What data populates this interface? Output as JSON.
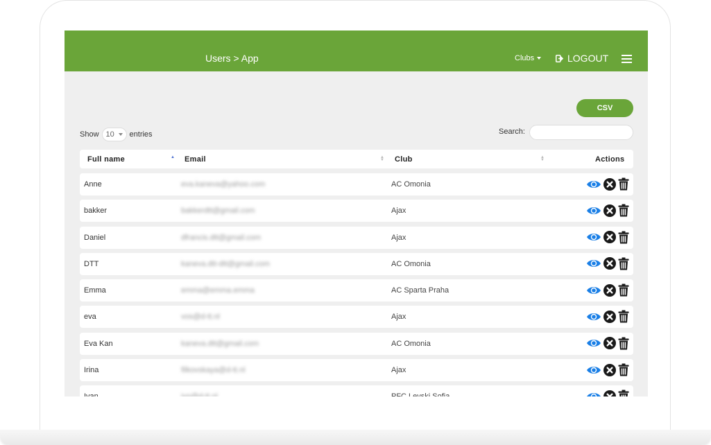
{
  "header": {
    "breadcrumb": "Users > App",
    "clubs_menu": "Clubs",
    "logout": "LOGOUT"
  },
  "toolbar": {
    "csv": "CSV",
    "show": "Show",
    "entries_value": "10",
    "entries": "entries",
    "search_label": "Search:",
    "search_value": ""
  },
  "table": {
    "columns": {
      "full_name": "Full name",
      "email": "Email",
      "club": "Club",
      "actions": "Actions"
    },
    "rows": [
      {
        "name": "Anne",
        "email": "eva.kaneva@yahoo.com",
        "club": "AC Omonia"
      },
      {
        "name": "bakker",
        "email": "bakkerdtt@gmail.com",
        "club": "Ajax"
      },
      {
        "name": "Daniel",
        "email": "dfrancis.dtt@gmail.com",
        "club": "Ajax"
      },
      {
        "name": "DTT",
        "email": "kaneva.dtt-dtt@gmail.com",
        "club": "AC Omonia"
      },
      {
        "name": "Emma",
        "email": "emma@emma.emma",
        "club": "AC Sparta Praha"
      },
      {
        "name": "eva",
        "email": "vos@d-tt.nl",
        "club": "Ajax"
      },
      {
        "name": "Eva Kan",
        "email": "kaneva.dtt@gmail.com",
        "club": "AC Omonia"
      },
      {
        "name": "Irina",
        "email": "filkovskaya@d-tt.nl",
        "club": "Ajax"
      },
      {
        "name": "Ivan",
        "email": "ivo@d-tt.nl",
        "club": "PFC Levski Sofia"
      }
    ]
  },
  "colors": {
    "brand_green": "#6aa539",
    "view_icon_blue": "#1a7fe6",
    "icon_dark": "#1a1a1a"
  }
}
